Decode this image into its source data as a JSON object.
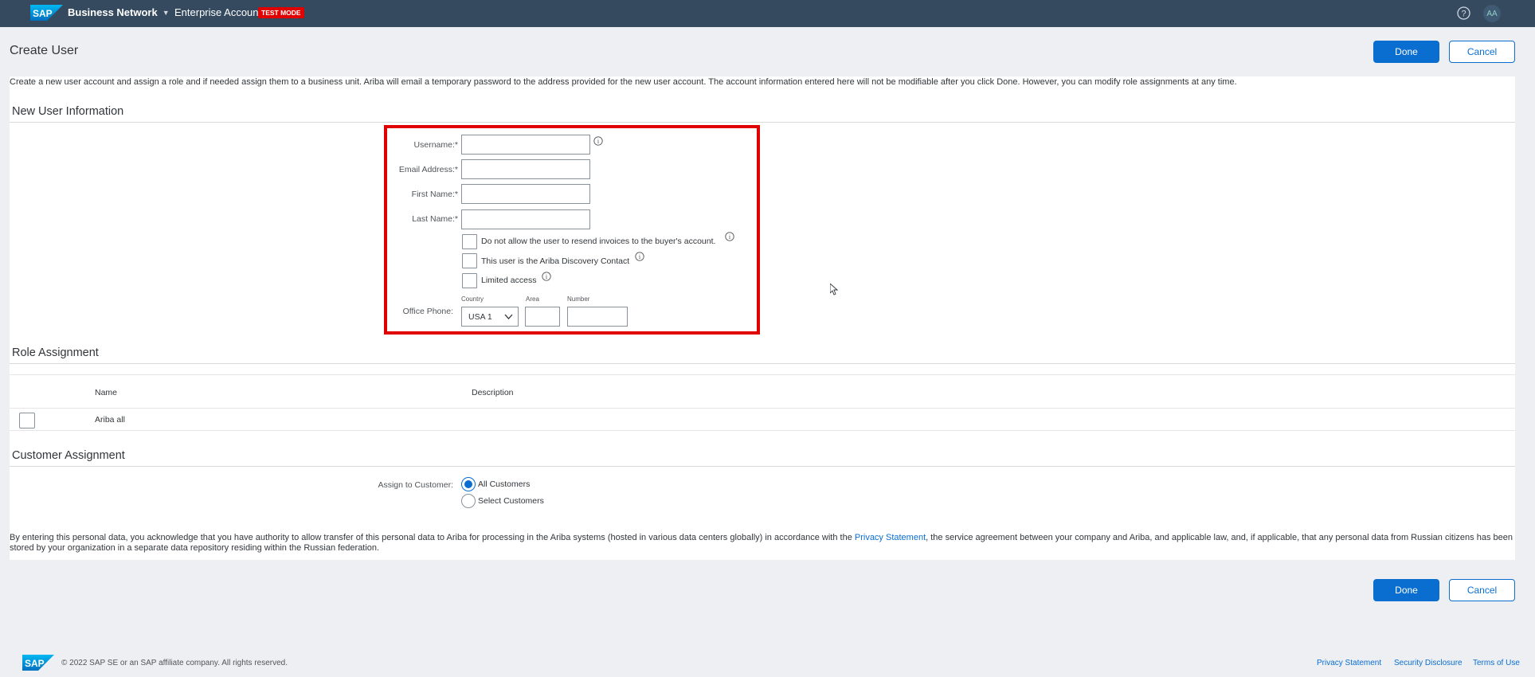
{
  "header": {
    "brand": "Business Network",
    "account": "Enterprise Account",
    "mode_badge": "TEST MODE",
    "logo_text": "SAP",
    "avatar_initials": "AA"
  },
  "page": {
    "title": "Create User",
    "done_label": "Done",
    "cancel_label": "Cancel",
    "intro": "Create a new user account and assign a role and if needed assign them to a business unit. Ariba will email a temporary password to the address provided for the new user account. The account information entered here will not be modifiable after you click Done. However, you can modify role assignments at any time."
  },
  "new_user": {
    "section_title": "New User Information",
    "username_label": "Username:*",
    "email_label": "Email Address:*",
    "first_name_label": "First Name:*",
    "last_name_label": "Last Name:*",
    "username_value": "",
    "email_value": "",
    "first_name_value": "",
    "last_name_value": "",
    "checkboxes": [
      {
        "label": "Do not allow the user to resend invoices to the buyer's account.",
        "checked": false
      },
      {
        "label": "This user is the Ariba Discovery Contact",
        "checked": false
      },
      {
        "label": "Limited access",
        "checked": false
      }
    ],
    "phone_label": "Office Phone:",
    "country_label": "Country",
    "area_label": "Area",
    "number_label": "Number",
    "country_value": "USA 1",
    "area_value": "",
    "number_value": ""
  },
  "roles": {
    "section_title": "Role Assignment",
    "columns": [
      "Name",
      "Description"
    ],
    "rows": [
      {
        "name": "Ariba all",
        "description": "",
        "checked": false
      }
    ]
  },
  "customers": {
    "section_title": "Customer Assignment",
    "assign_label": "Assign to Customer:",
    "options": [
      {
        "label": "All Customers",
        "selected": true
      },
      {
        "label": "Select Customers",
        "selected": false
      }
    ]
  },
  "privacy": {
    "before": "By entering this personal data, you acknowledge that you have authority to allow transfer of this personal data to Ariba for processing in the Ariba systems (hosted in various data centers globally) in accordance with the ",
    "link": "Privacy Statement",
    "after": ", the service agreement between your company and Ariba, and applicable law, and, if applicable, that any personal data from Russian citizens has been stored by your organization in a separate data repository residing within the Russian federation."
  },
  "footer": {
    "copyright": "© 2022 SAP SE or an SAP affiliate company. All rights reserved.",
    "links": [
      "Privacy Statement",
      "Security Disclosure",
      "Terms of Use"
    ]
  },
  "colors": {
    "shell": "#354a5f",
    "accent": "#0a6ed1",
    "highlight": "#e00000"
  }
}
